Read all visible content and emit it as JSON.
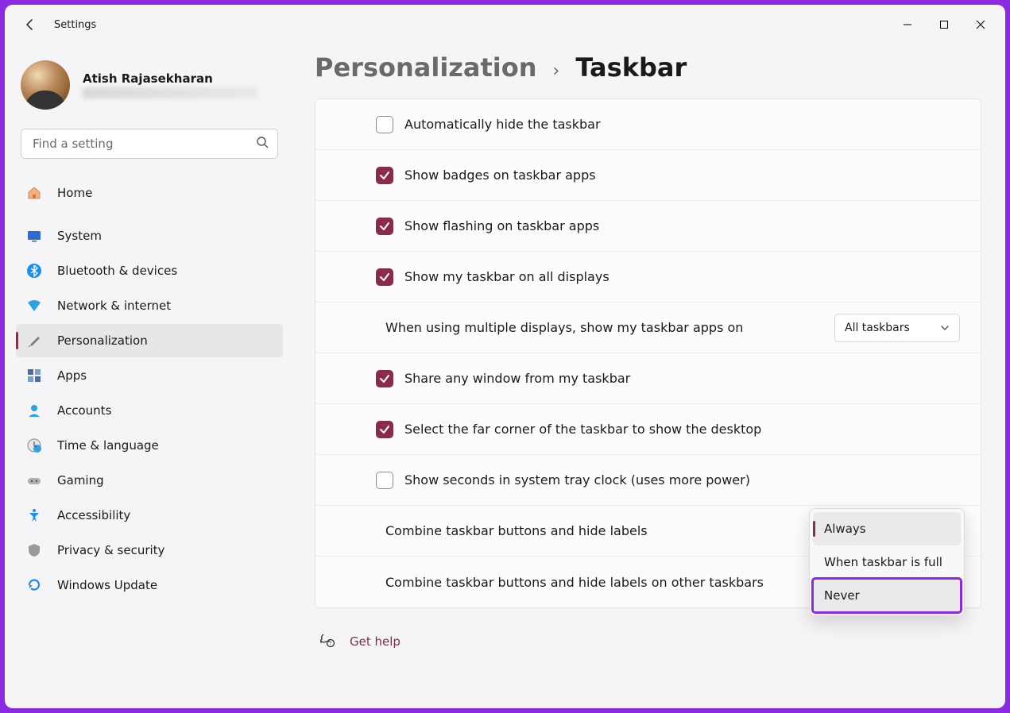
{
  "app": {
    "title": "Settings"
  },
  "user": {
    "name": "Atish Rajasekharan",
    "email_hidden": true
  },
  "search": {
    "placeholder": "Find a setting"
  },
  "sidebar": {
    "items": [
      {
        "id": "home",
        "label": "Home"
      },
      {
        "id": "system",
        "label": "System"
      },
      {
        "id": "bluetooth",
        "label": "Bluetooth & devices"
      },
      {
        "id": "network",
        "label": "Network & internet"
      },
      {
        "id": "personalization",
        "label": "Personalization",
        "active": true
      },
      {
        "id": "apps",
        "label": "Apps"
      },
      {
        "id": "accounts",
        "label": "Accounts"
      },
      {
        "id": "time",
        "label": "Time & language"
      },
      {
        "id": "gaming",
        "label": "Gaming"
      },
      {
        "id": "accessibility",
        "label": "Accessibility"
      },
      {
        "id": "privacy",
        "label": "Privacy & security"
      },
      {
        "id": "update",
        "label": "Windows Update"
      }
    ]
  },
  "breadcrumbs": {
    "parent": "Personalization",
    "current": "Taskbar"
  },
  "settings": {
    "auto_hide": {
      "label": "Automatically hide the taskbar",
      "checked": false
    },
    "show_badges": {
      "label": "Show badges on taskbar apps",
      "checked": true
    },
    "show_flashing": {
      "label": "Show flashing on taskbar apps",
      "checked": true
    },
    "all_displays": {
      "label": "Show my taskbar on all displays",
      "checked": true
    },
    "multi_show_on": {
      "label": "When using multiple displays, show my taskbar apps on",
      "value": "All taskbars"
    },
    "share_window": {
      "label": "Share any window from my taskbar",
      "checked": true
    },
    "far_corner": {
      "label": "Select the far corner of the taskbar to show the desktop",
      "checked": true
    },
    "show_seconds": {
      "label": "Show seconds in system tray clock (uses more power)",
      "checked": false
    },
    "combine_primary": {
      "label": "Combine taskbar buttons and hide labels"
    },
    "combine_other": {
      "label": "Combine taskbar buttons and hide labels on other taskbars"
    }
  },
  "flyout": {
    "options": [
      {
        "label": "Always",
        "selected": true
      },
      {
        "label": "When taskbar is full",
        "selected": false
      },
      {
        "label": "Never",
        "selected": false,
        "highlighted": true
      }
    ]
  },
  "help": {
    "label": "Get help"
  }
}
